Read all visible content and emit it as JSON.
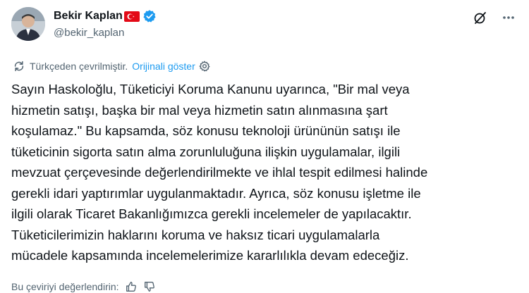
{
  "user": {
    "name": "Bekir Kaplan",
    "handle": "@bekir_kaplan",
    "flag_icon": "turkey-flag-icon",
    "verified_icon": "verified-badge-icon",
    "verified_color": "#1d9bf0"
  },
  "top_actions": {
    "grok_icon": "grok-icon",
    "more_icon": "more-icon"
  },
  "translation": {
    "label": "Türkçeden çevrilmiştir.",
    "show_original": "Orijinali göster",
    "translate_icon": "translate-icon",
    "settings_icon": "gear-icon"
  },
  "tweet": {
    "lines": [
      "Sayın Haskoloğlu, Tüketiciyi Koruma Kanunu uyarınca, \"Bir mal veya",
      "hizmetin satışı, başka bir mal veya hizmetin satın alınmasına şart",
      "koşulamaz.\" Bu kapsamda, söz konusu teknoloji ürününün satışı ile",
      "tüketicinin sigorta satın alma zorunluluğuna ilişkin uygulamalar, ilgili",
      "mevzuat çerçevesinde değerlendirilmekte ve ihlal tespit edilmesi halinde",
      "gerekli idari yaptırımlar uygulanmaktadır. Ayrıca, söz konusu işletme ile",
      "ilgili olarak Ticaret Bakanlığımızca gerekli incelemeler de yapılacaktır.",
      "Tüketicilerimizin haklarını koruma ve haksız ticari uygulamalarla",
      "mücadele kapsamında incelemelerimize kararlılıkla devam edeceğiz."
    ]
  },
  "rating": {
    "label": "Bu çeviriyi değerlendirin:",
    "thumbs_up_icon": "thumbs-up-icon",
    "thumbs_down_icon": "thumbs-down-icon"
  },
  "colors": {
    "text": "#0f1419",
    "secondary": "#536471",
    "link": "#1d9bf0",
    "flag_red": "#e30a17"
  }
}
